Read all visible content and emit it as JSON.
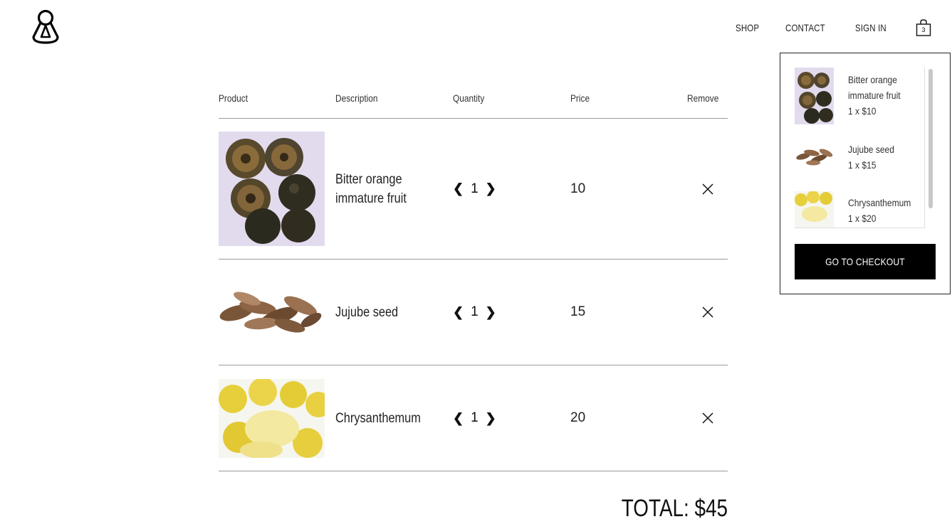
{
  "nav": {
    "shop": "SHOP",
    "contact": "CONTACT",
    "signin": "SIGN IN",
    "cart_count": "3"
  },
  "table": {
    "headers": {
      "product": "Product",
      "description": "Description",
      "quantity": "Quantity",
      "price": "Price",
      "remove": "Remove"
    },
    "rows": [
      {
        "name": "Bitter orange immature fruit",
        "qty": "1",
        "price": "10"
      },
      {
        "name": "Jujube seed",
        "qty": "1",
        "price": "15"
      },
      {
        "name": "Chrysanthemum",
        "qty": "1",
        "price": "20"
      }
    ]
  },
  "total": "TOTAL: $45",
  "mini_cart": {
    "items": [
      {
        "name": "Bitter orange immature fruit",
        "line": "1 x $10"
      },
      {
        "name": "Jujube seed",
        "line": "1 x $15"
      },
      {
        "name": "Chrysanthemum",
        "line": "1 x $20"
      }
    ],
    "checkout_label": "GO TO CHECKOUT"
  },
  "icons": {
    "logo": "logo-icon",
    "cart": "shopping-bag-icon",
    "prev": "chevron-left-icon",
    "next": "chevron-right-icon",
    "remove": "close-icon"
  }
}
